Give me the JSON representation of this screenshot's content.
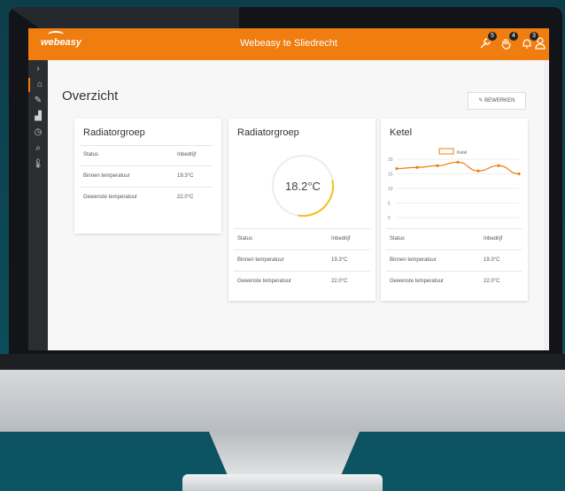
{
  "header": {
    "logo": "webeasy",
    "title": "Webeasy te Sliedrecht",
    "icons": [
      {
        "name": "wrench-icon",
        "badge": "5"
      },
      {
        "name": "hand-icon",
        "badge": "4"
      },
      {
        "name": "bell-icon",
        "badge": "3"
      },
      {
        "name": "user-icon",
        "badge": ""
      }
    ]
  },
  "sidebar": {
    "items": [
      "expand-icon",
      "home-icon",
      "clip-icon",
      "chart-icon",
      "clock-icon",
      "search-icon",
      "thermometer-icon"
    ]
  },
  "page": {
    "title": "Overzicht",
    "edit_label": "BEWERKEN"
  },
  "cards": [
    {
      "title": "Radiatorgroep",
      "rows": [
        [
          "Status",
          "Inbedrijf"
        ],
        [
          "Binnen temperatuur",
          "19.3°C"
        ],
        [
          "Gewenste temperatuur",
          "22.0°C"
        ]
      ]
    },
    {
      "title": "Radiatorgroep",
      "gauge": "18.2°C",
      "gauge_fraction": 0.3,
      "rows": [
        [
          "Status",
          "Inbedrijf"
        ],
        [
          "Binnen temperatuur",
          "19.3°C"
        ],
        [
          "Gewenste temperatuur",
          "22.0°C"
        ]
      ]
    },
    {
      "title": "Ketel",
      "rows": [
        [
          "Status",
          "Inbedrijf"
        ],
        [
          "Binnen temperatuur",
          "19.3°C"
        ],
        [
          "Gewenste temperatuur",
          "22.0°C"
        ]
      ]
    }
  ],
  "chart_data": {
    "type": "line",
    "legend": "Ketel",
    "yticks": [
      "20",
      "15",
      "10",
      "5",
      "0"
    ],
    "ylim": [
      0,
      20
    ],
    "series": [
      {
        "name": "Ketel",
        "values": [
          16.8,
          17.2,
          17.8,
          19,
          16,
          17.8,
          15
        ]
      }
    ],
    "color": "#ef7d10"
  }
}
